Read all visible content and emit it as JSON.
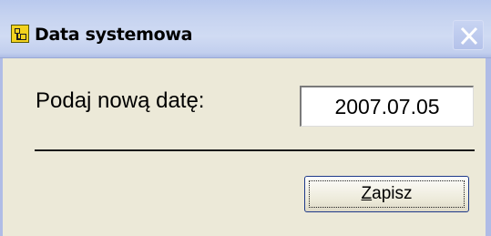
{
  "window": {
    "title": "Data systemowa",
    "icon": "app-icon",
    "close_icon": "close-icon"
  },
  "form": {
    "prompt_label": "Podaj nową datę:",
    "date_value": "2007.07.05"
  },
  "buttons": {
    "save_accel": "Z",
    "save_rest": "apisz"
  },
  "colors": {
    "dialog_bg": "#ece9d8",
    "titlebar": "#c6d3f0",
    "button_border": "#1f3a8a"
  }
}
